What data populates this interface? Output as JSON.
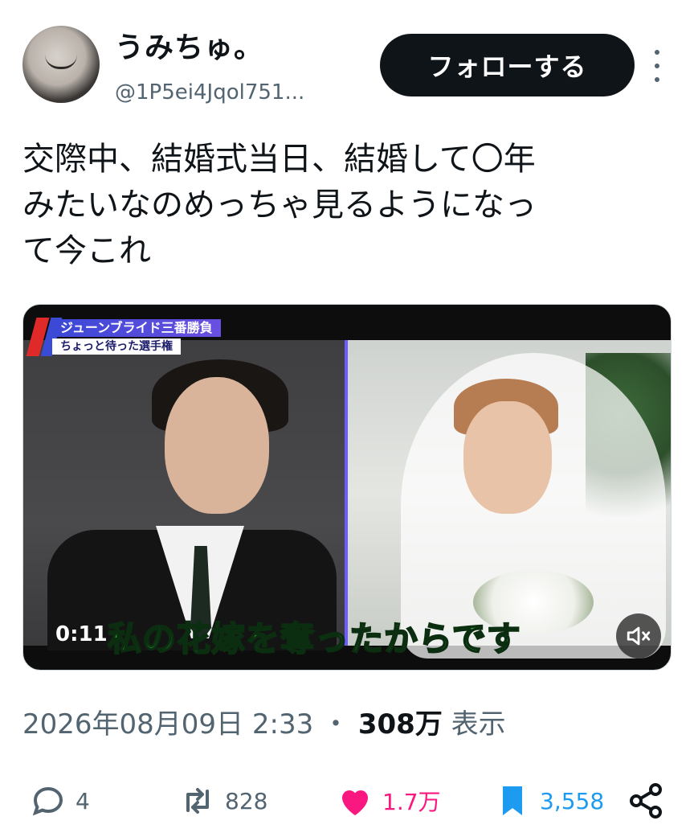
{
  "author": {
    "display_name": "うみちゅ。",
    "handle": "@1P5ei4Jqol751..."
  },
  "follow_button": {
    "label": "フォローする"
  },
  "tweet": {
    "text": "交際中、結婚式当日、結婚して〇年\nみたいなのめっちゃ見るようになっ\nて今これ"
  },
  "media": {
    "show_tag_line1": "ジューンブライド三番勝負",
    "show_tag_line2": "ちょっと待った選手権",
    "subtitle": "私の花嫁を奪ったからです",
    "timecode": "0:11",
    "muted": true
  },
  "meta": {
    "datetime": "2026年08月09日 2:33",
    "separator": "・",
    "views": "308万",
    "views_label": "表示"
  },
  "actions": {
    "replies": "4",
    "retweets": "828",
    "likes": "1.7万",
    "bookmarks": "3,558"
  },
  "icons": {
    "reply": "speech-bubble-icon",
    "retweet": "retweet-icon",
    "like": "heart-icon",
    "bookmark": "bookmark-icon",
    "share": "share-icon",
    "more": "vertical-ellipsis-icon",
    "mute": "speaker-muted-icon"
  },
  "colors": {
    "like": "#f91880",
    "bookmark": "#1d9bf0",
    "muted_text": "#536471"
  }
}
